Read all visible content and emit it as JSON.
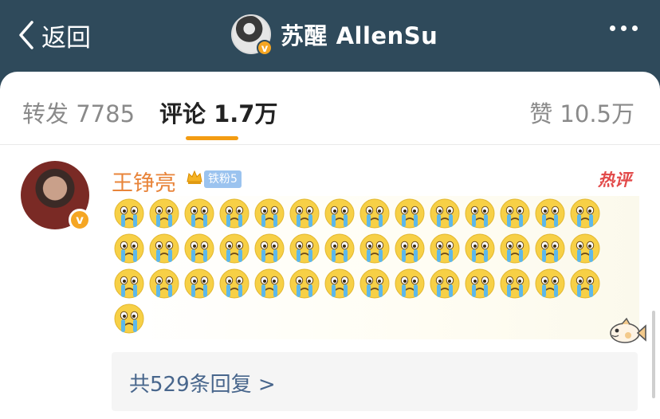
{
  "header": {
    "back_label": "返回",
    "title": "苏醒 AllenSu",
    "avatar_badge": "v"
  },
  "tabs": {
    "repost": "转发 7785",
    "comments": "评论 1.7万",
    "likes": "赞 10.5万"
  },
  "comment": {
    "name": "王铮亮",
    "fan_badge": "铁粉5",
    "hot_tag": "热评",
    "avatar_badge": "v",
    "emoji_name": "crying-face-emoji",
    "emoji_count": 43,
    "reply_link": "共529条回复 >"
  },
  "colors": {
    "header_bg": "#2f4a5b",
    "accent": "#f39c12",
    "name": "#e8843a",
    "link": "#48668c",
    "hot": "#e24a4a"
  }
}
